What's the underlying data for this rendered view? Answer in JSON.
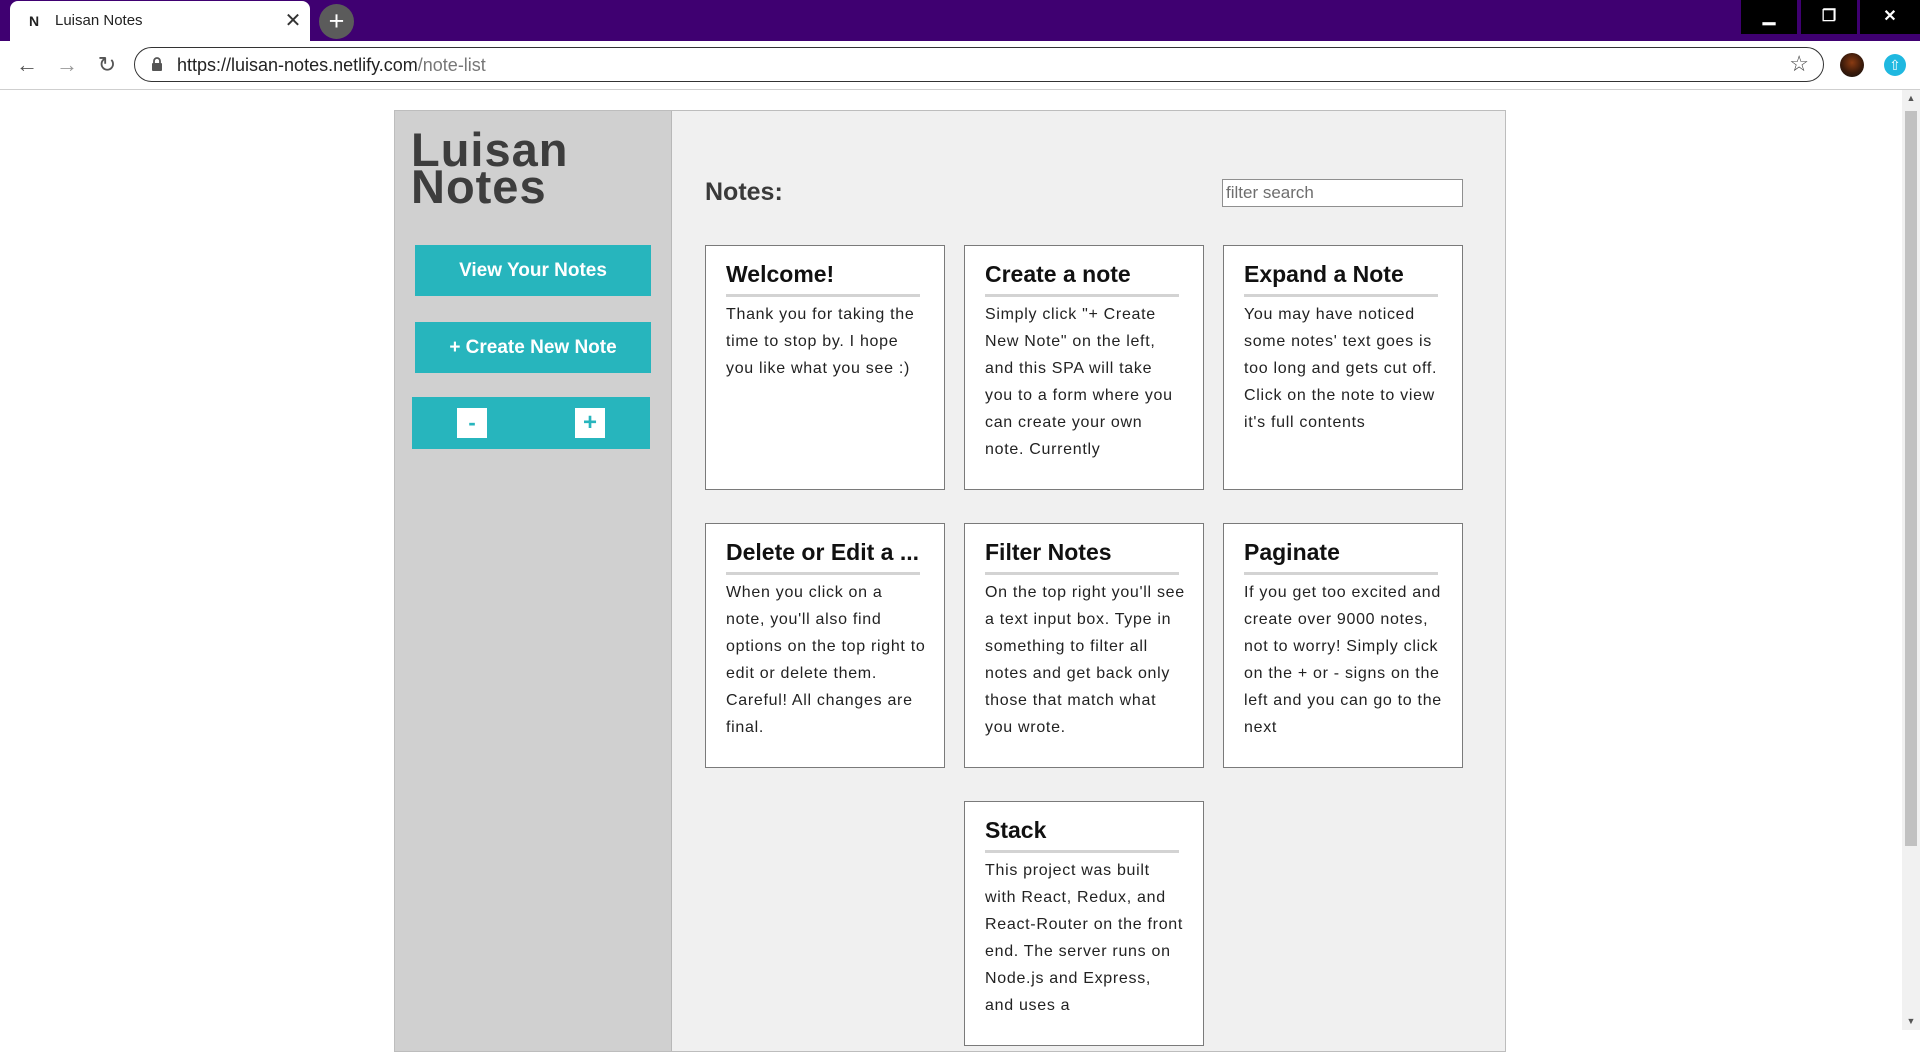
{
  "browser": {
    "tab": {
      "favicon": "N",
      "title": "Luisan Notes",
      "close": "✕"
    },
    "new_tab": "+",
    "window_controls": {
      "minimize": "▁",
      "maximize": "❐",
      "close": "✕"
    },
    "nav": {
      "back": "←",
      "forward": "→",
      "reload": "↻"
    },
    "url": {
      "host": "https://luisan-notes.netlify.com",
      "path": "/note-list"
    },
    "bookmark": "☆"
  },
  "sidebar": {
    "brand": "Luisan Notes",
    "view_notes": "View Your Notes",
    "create_note": "+ Create New Note",
    "page_prev": "-",
    "page_next": "+"
  },
  "main": {
    "heading": "Notes:",
    "filter_placeholder": "filter search",
    "notes": [
      {
        "title": "Welcome!",
        "body": "Thank you for taking the time to stop by. I hope you like what you see :)"
      },
      {
        "title": "Create a note",
        "body": "Simply click \"+ Create New Note\" on the left, and this SPA will take you to a form where you can create your own note. Currently"
      },
      {
        "title": "Expand a Note",
        "body": "You may have noticed some notes' text goes is too long and gets cut off. Click on the note to view it's full contents"
      },
      {
        "title": "Delete or Edit a ...",
        "body": "When you click on a note, you'll also find options on the top right to edit or delete them. Careful! All changes are final."
      },
      {
        "title": "Filter Notes",
        "body": "On the top right you'll see a text input box. Type in something to filter all notes and get back only those that match what you wrote."
      },
      {
        "title": "Paginate",
        "body": "If you get too excited and create over 9000 notes, not to worry! Simply click on the + or - signs on the left and you can go to the next"
      },
      {
        "title": "Stack",
        "body": "This project was built with React, Redux, and React-Router on the front end. The server runs on Node.js and Express, and uses a"
      }
    ]
  },
  "colors": {
    "titlebar": "#3f0071",
    "accent": "#27b5bd",
    "sidebar": "#d0d0d0",
    "content": "#f0f0f0"
  },
  "icons": [
    "lock-icon",
    "star-icon",
    "back-arrow-icon",
    "forward-arrow-icon",
    "reload-icon",
    "plus-icon",
    "close-icon"
  ]
}
